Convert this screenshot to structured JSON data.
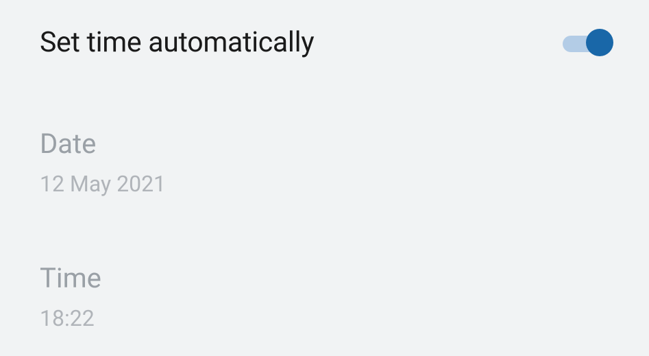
{
  "auto_time": {
    "label": "Set time automatically",
    "enabled": true
  },
  "date": {
    "label": "Date",
    "value": "12 May 2021"
  },
  "time": {
    "label": "Time",
    "value": "18:22"
  }
}
